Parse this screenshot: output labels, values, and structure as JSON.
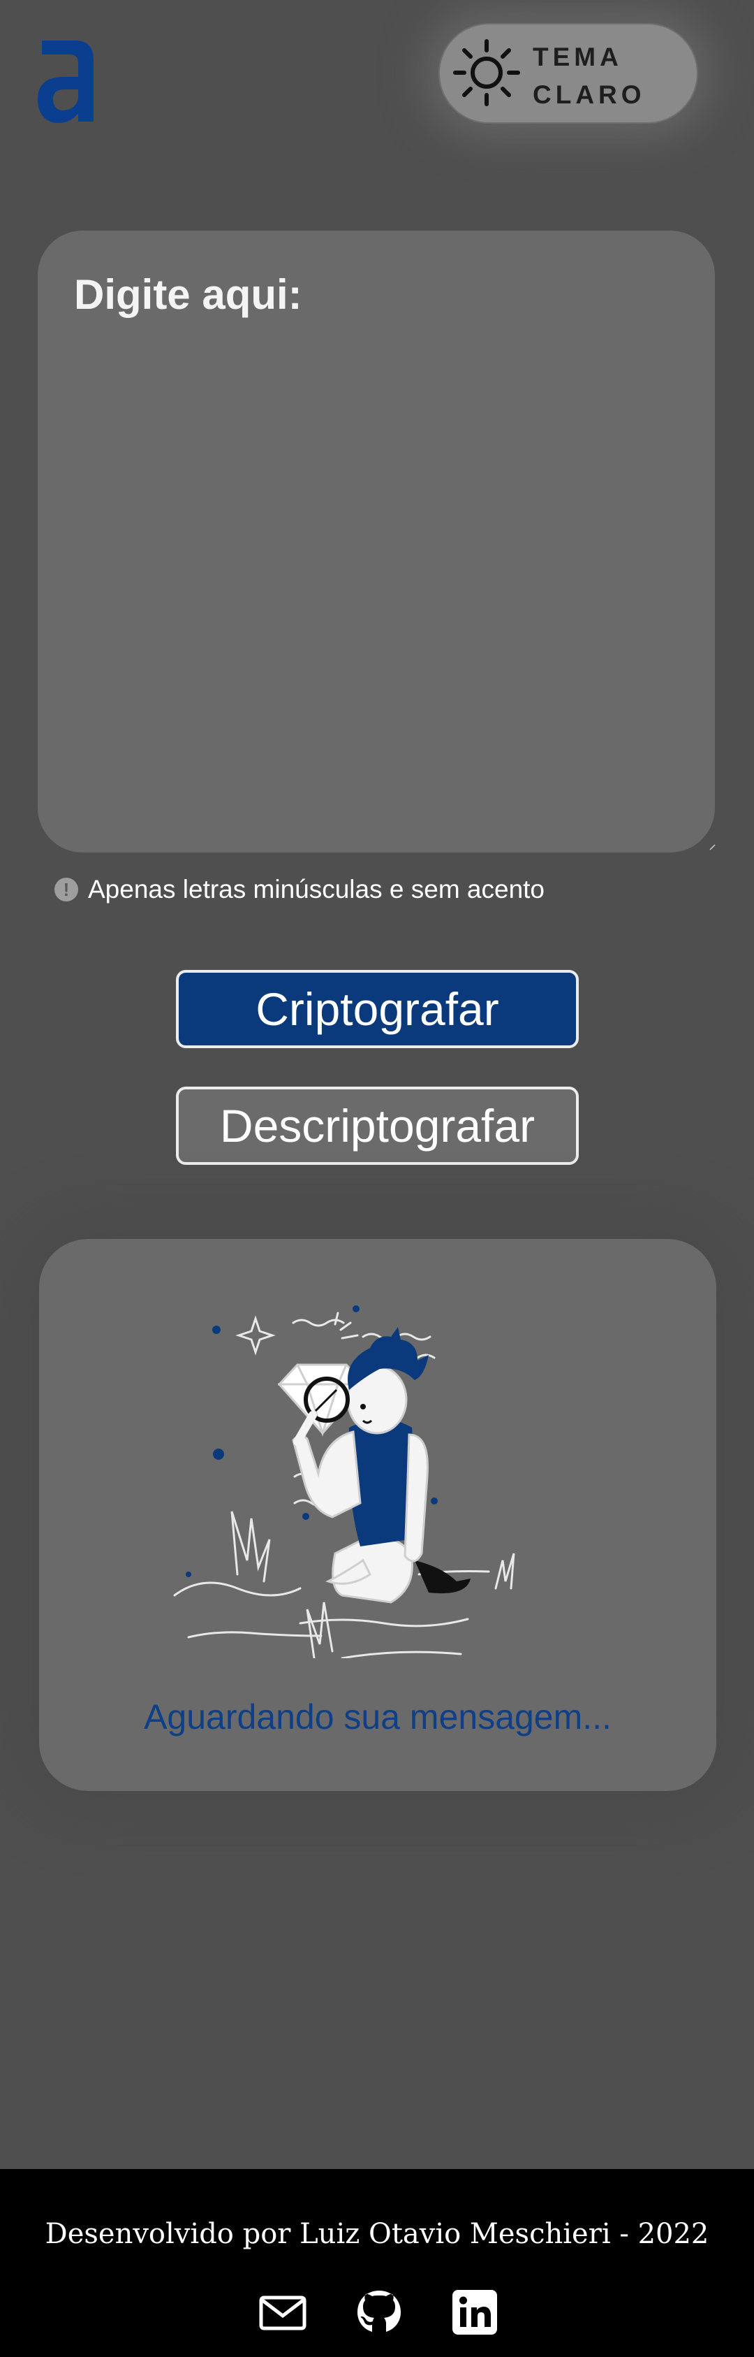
{
  "header": {
    "logo_icon": "alura-a-logo-icon",
    "theme_toggle": {
      "icon": "sun-icon",
      "label_line1": "TEMA",
      "label_line2": "CLARO"
    }
  },
  "input": {
    "placeholder": "Digite aqui:",
    "value": ""
  },
  "hint": {
    "icon": "info-icon",
    "text": "Apenas letras minúsculas e sem acento"
  },
  "buttons": {
    "encrypt_label": "Criptografar",
    "decrypt_label": "Descriptografar"
  },
  "output": {
    "illustration": "person-with-magnifying-glass-and-diamond-illustration",
    "waiting_text": "Aguardando sua mensagem..."
  },
  "footer": {
    "credit": "Desenvolvido por Luiz Otavio Meschieri - 2022",
    "links": [
      {
        "icon": "mail-icon"
      },
      {
        "icon": "github-icon"
      },
      {
        "icon": "linkedin-icon"
      }
    ]
  },
  "colors": {
    "background": "#4f4f4f",
    "card": "#6a6a6a",
    "accent_blue": "#0a3a7c",
    "footer": "#000000"
  }
}
